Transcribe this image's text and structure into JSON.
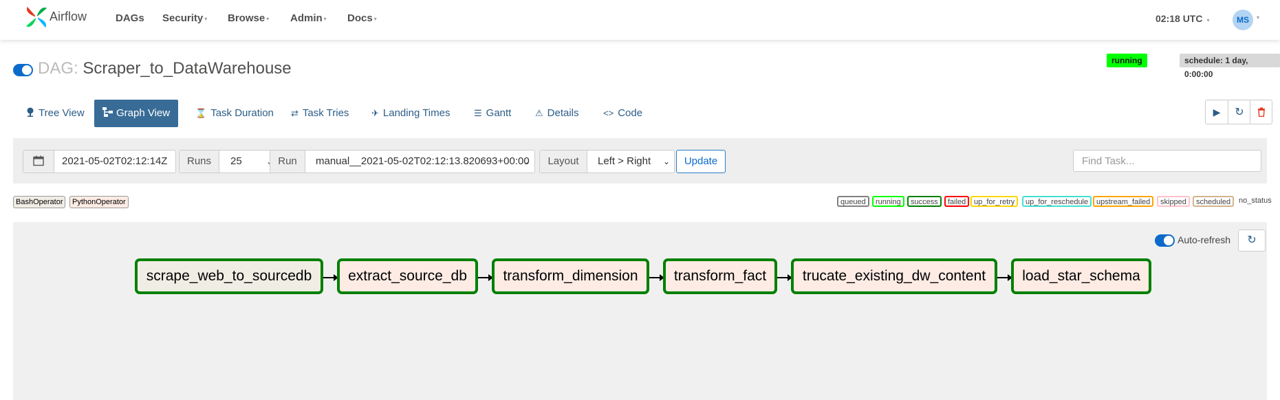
{
  "nav": {
    "brand": "Airflow",
    "items": [
      {
        "label": "DAGs",
        "caret": ""
      },
      {
        "label": "Security",
        "caret": "▾"
      },
      {
        "label": "Browse",
        "caret": "▾"
      },
      {
        "label": "Admin",
        "caret": "▾"
      },
      {
        "label": "Docs",
        "caret": "▾"
      }
    ],
    "time": "02:18 UTC",
    "avatar": "MS"
  },
  "dag": {
    "prefix": "DAG:",
    "name": "Scraper_to_DataWarehouse",
    "status": "running",
    "schedule": "schedule: 1 day, 0:00:00"
  },
  "tabs": [
    {
      "label": "Tree View",
      "icon": "tree-icon"
    },
    {
      "label": "Graph View",
      "icon": "graph-icon"
    },
    {
      "label": "Task Duration",
      "icon": "hourglass-icon"
    },
    {
      "label": "Task Tries",
      "icon": "retry-icon"
    },
    {
      "label": "Landing Times",
      "icon": "plane-landing-icon"
    },
    {
      "label": "Gantt",
      "icon": "gantt-icon"
    },
    {
      "label": "Details",
      "icon": "warning-icon"
    },
    {
      "label": "Code",
      "icon": "code-icon"
    }
  ],
  "active_tab": "Graph View",
  "toolbar": {
    "date": "2021-05-02T02:12:14Z",
    "runs_label": "Runs",
    "runs_value": "25",
    "run_label": "Run",
    "run_value": "manual__2021-05-02T02:12:13.820693+00:00",
    "layout_label": "Layout",
    "layout_value": "Left > Right",
    "update": "Update",
    "find_placeholder": "Find Task..."
  },
  "operators": [
    "BashOperator",
    "PythonOperator"
  ],
  "states": [
    {
      "label": "queued",
      "color": "#808080"
    },
    {
      "label": "running",
      "color": "#00ff00"
    },
    {
      "label": "success",
      "color": "#008000"
    },
    {
      "label": "failed",
      "color": "#ff0000"
    },
    {
      "label": "up_for_retry",
      "color": "#ffd700"
    },
    {
      "label": "up_for_reschedule",
      "color": "#40e0d0"
    },
    {
      "label": "upstream_failed",
      "color": "#ffa500"
    },
    {
      "label": "skipped",
      "color": "#ffc0cb"
    },
    {
      "label": "scheduled",
      "color": "#d2b48c"
    },
    {
      "label": "no_status",
      "color": ""
    }
  ],
  "graph": {
    "auto_refresh": "Auto-refresh",
    "tasks": [
      {
        "name": "scrape_web_to_sourcedb",
        "operator": "BashOperator",
        "state": "success"
      },
      {
        "name": "extract_source_db",
        "operator": "PythonOperator",
        "state": "success"
      },
      {
        "name": "transform_dimension",
        "operator": "PythonOperator",
        "state": "success"
      },
      {
        "name": "transform_fact",
        "operator": "PythonOperator",
        "state": "success"
      },
      {
        "name": "trucate_existing_dw_content",
        "operator": "PythonOperator",
        "state": "success"
      },
      {
        "name": "load_star_schema",
        "operator": "PythonOperator",
        "state": "success"
      }
    ]
  }
}
